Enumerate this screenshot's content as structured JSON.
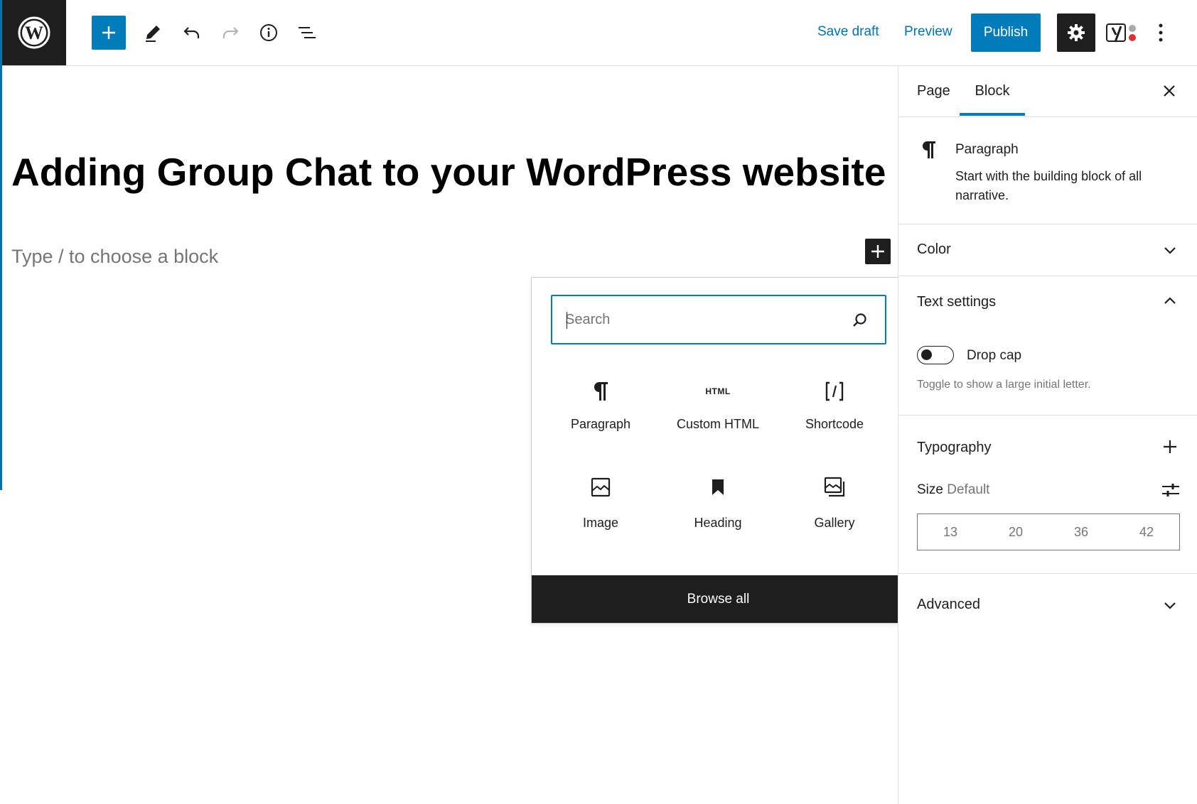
{
  "toolbar": {
    "save_draft_label": "Save draft",
    "preview_label": "Preview",
    "publish_label": "Publish"
  },
  "editor": {
    "post_title": "Adding Group Chat to your WordPress website",
    "block_placeholder": "Type / to choose a block"
  },
  "inserter": {
    "search_placeholder": "Search",
    "blocks": [
      {
        "label": "Paragraph",
        "icon": "paragraph-icon"
      },
      {
        "label": "Custom HTML",
        "icon": "html-icon",
        "glyph": "HTML"
      },
      {
        "label": "Shortcode",
        "icon": "shortcode-icon",
        "glyph": "[/]"
      },
      {
        "label": "Image",
        "icon": "image-icon"
      },
      {
        "label": "Heading",
        "icon": "bookmark-icon"
      },
      {
        "label": "Gallery",
        "icon": "gallery-icon"
      }
    ],
    "browse_all_label": "Browse all"
  },
  "sidebar": {
    "tabs": [
      {
        "label": "Page",
        "active": false
      },
      {
        "label": "Block",
        "active": true
      }
    ],
    "block_card": {
      "title": "Paragraph",
      "description": "Start with the building block of all narrative."
    },
    "panels": {
      "color": {
        "title": "Color",
        "expanded": false
      },
      "text_settings": {
        "title": "Text settings",
        "expanded": true,
        "drop_cap_label": "Drop cap",
        "drop_cap_help": "Toggle to show a large initial letter."
      },
      "typography": {
        "title": "Typography",
        "size_label": "Size",
        "size_value": "Default",
        "sizes": [
          "13",
          "20",
          "36",
          "42"
        ]
      },
      "advanced": {
        "title": "Advanced",
        "expanded": false
      }
    }
  },
  "colors": {
    "accent": "#007cba",
    "dark": "#1e1e1e",
    "muted": "#757575",
    "yoast_dot": "#dc3232"
  }
}
